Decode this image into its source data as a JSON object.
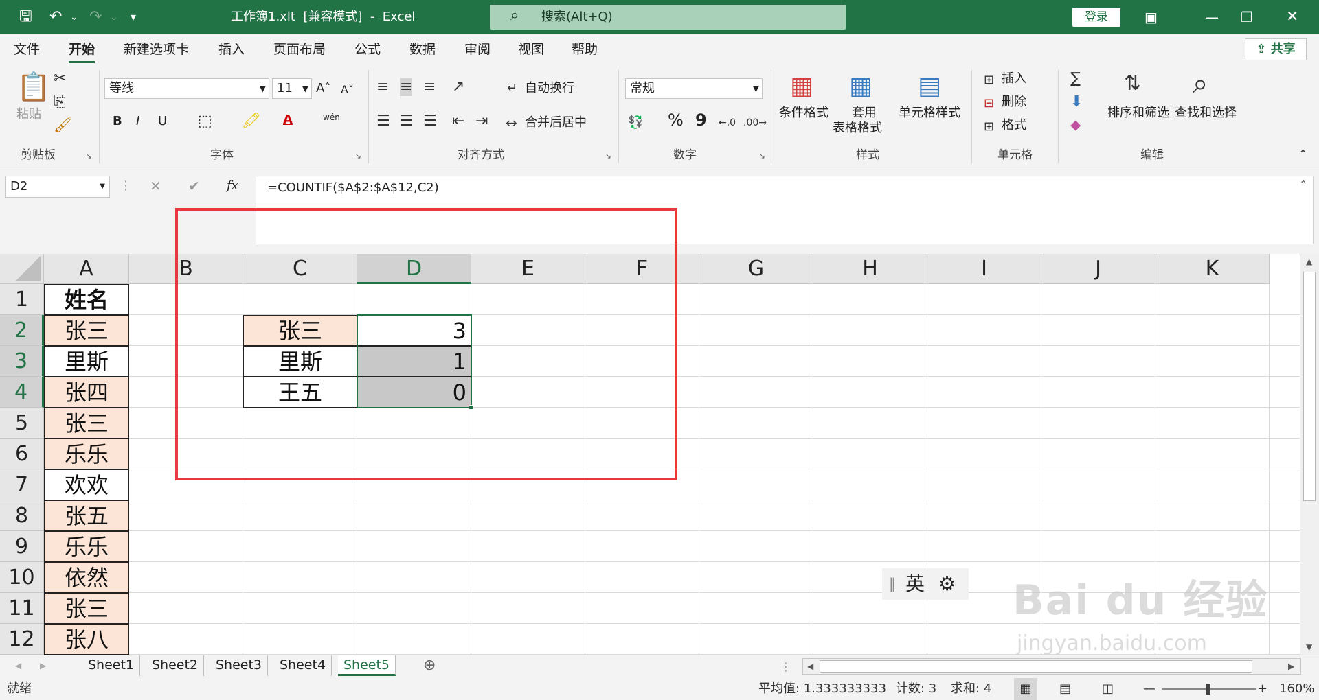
{
  "titlebar": {
    "title": "工作簿1.xlt  [兼容模式]  -  Excel",
    "search_placeholder": "搜索(Alt+Q)",
    "login_label": "登录"
  },
  "tabs": [
    "文件",
    "开始",
    "新建选项卡",
    "插入",
    "页面布局",
    "公式",
    "数据",
    "审阅",
    "视图",
    "帮助"
  ],
  "share_label": "共享",
  "ribbon": {
    "clipboard": {
      "paste": "粘贴",
      "group": "剪贴板"
    },
    "font": {
      "name": "等线",
      "size": "11",
      "group": "字体",
      "bold": "B",
      "italic": "I",
      "underline": "U",
      "phonetic": "wén"
    },
    "align": {
      "wrap": "自动换行",
      "merge": "合并后居中",
      "group": "对齐方式"
    },
    "number": {
      "format": "常规",
      "group": "数字",
      "percent": "%",
      "comma": "9"
    },
    "styles": {
      "cond": "条件格式",
      "table1": "套用",
      "table2": "表格格式",
      "cell": "单元格样式",
      "group": "样式"
    },
    "cells": {
      "insert": "插入",
      "delete": "删除",
      "format": "格式",
      "group": "单元格"
    },
    "edit": {
      "sort": "排序和筛选",
      "find": "查找和选择",
      "group": "编辑"
    }
  },
  "formula": {
    "name_box": "D2",
    "fx": "fx",
    "text": "=COUNTIF($A$2:$A$12,C2)"
  },
  "columns": [
    "A",
    "B",
    "C",
    "D",
    "E",
    "F",
    "G",
    "H",
    "I",
    "J",
    "K"
  ],
  "rows": [
    "1",
    "2",
    "3",
    "4",
    "5",
    "6",
    "7",
    "8",
    "9",
    "10",
    "11",
    "12"
  ],
  "colA": [
    "姓名",
    "张三",
    "里斯",
    "张四",
    "张三",
    "乐乐",
    "欢欢",
    "张五",
    "乐乐",
    "依然",
    "张三",
    "张八"
  ],
  "lookup": {
    "names": [
      "张三",
      "里斯",
      "王五"
    ],
    "counts": [
      "3",
      "1",
      "0"
    ]
  },
  "ime": {
    "lang": "英"
  },
  "sheets": [
    "Sheet1",
    "Sheet2",
    "Sheet3",
    "Sheet4",
    "Sheet5"
  ],
  "status": {
    "ready": "就绪",
    "avg": "平均值: 1.333333333",
    "count": "计数: 3",
    "sum": "求和: 4",
    "zoom": "160%"
  },
  "watermark": {
    "big": "Bai du 经验",
    "small": "jingyan.baidu.com"
  },
  "colors": {
    "excel_green": "#217346",
    "pink_fill": "#fce4d6",
    "gray_fill": "#c8c8c8",
    "highlight_red": "#e8383d"
  }
}
